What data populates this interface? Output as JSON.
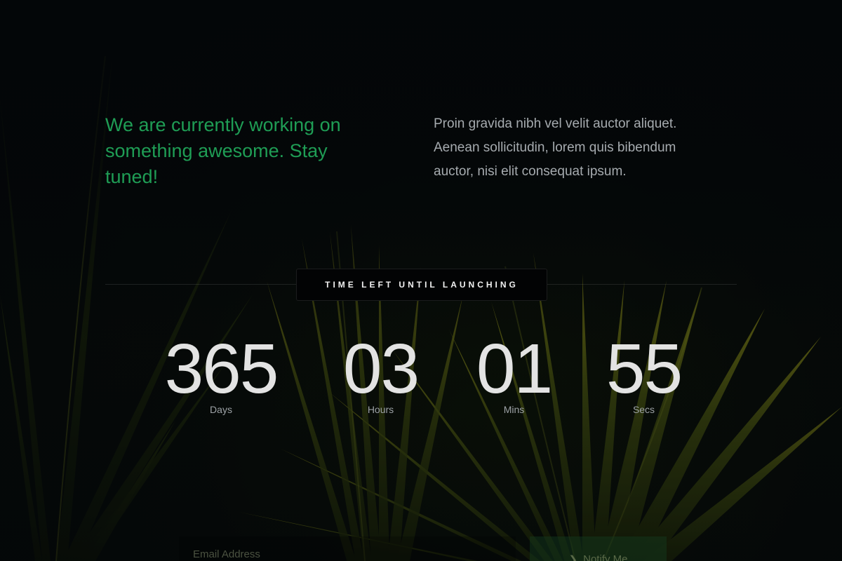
{
  "hero": {
    "headline": "We are currently working on something awesome. Stay tuned!",
    "description": "Proin gravida nibh vel velit auctor aliquet. Aenean sollicitudin, lorem quis bibendum auctor, nisi elit consequat ipsum."
  },
  "countdown": {
    "badge": "TIME LEFT UNTIL LAUNCHING",
    "days": {
      "value": "365",
      "label": "Days"
    },
    "hours": {
      "value": "03",
      "label": "Hours"
    },
    "mins": {
      "value": "01",
      "label": "Mins"
    },
    "secs": {
      "value": "55",
      "label": "Secs"
    }
  },
  "subscribe": {
    "placeholder": "Email Address",
    "button_label": "Notify Me",
    "button_icon": "arrow-right-icon"
  },
  "colors": {
    "accent": "#1f9d55",
    "background": "#05080a",
    "digits": "#e3e3e3",
    "muted_text": "#a6abaf"
  }
}
